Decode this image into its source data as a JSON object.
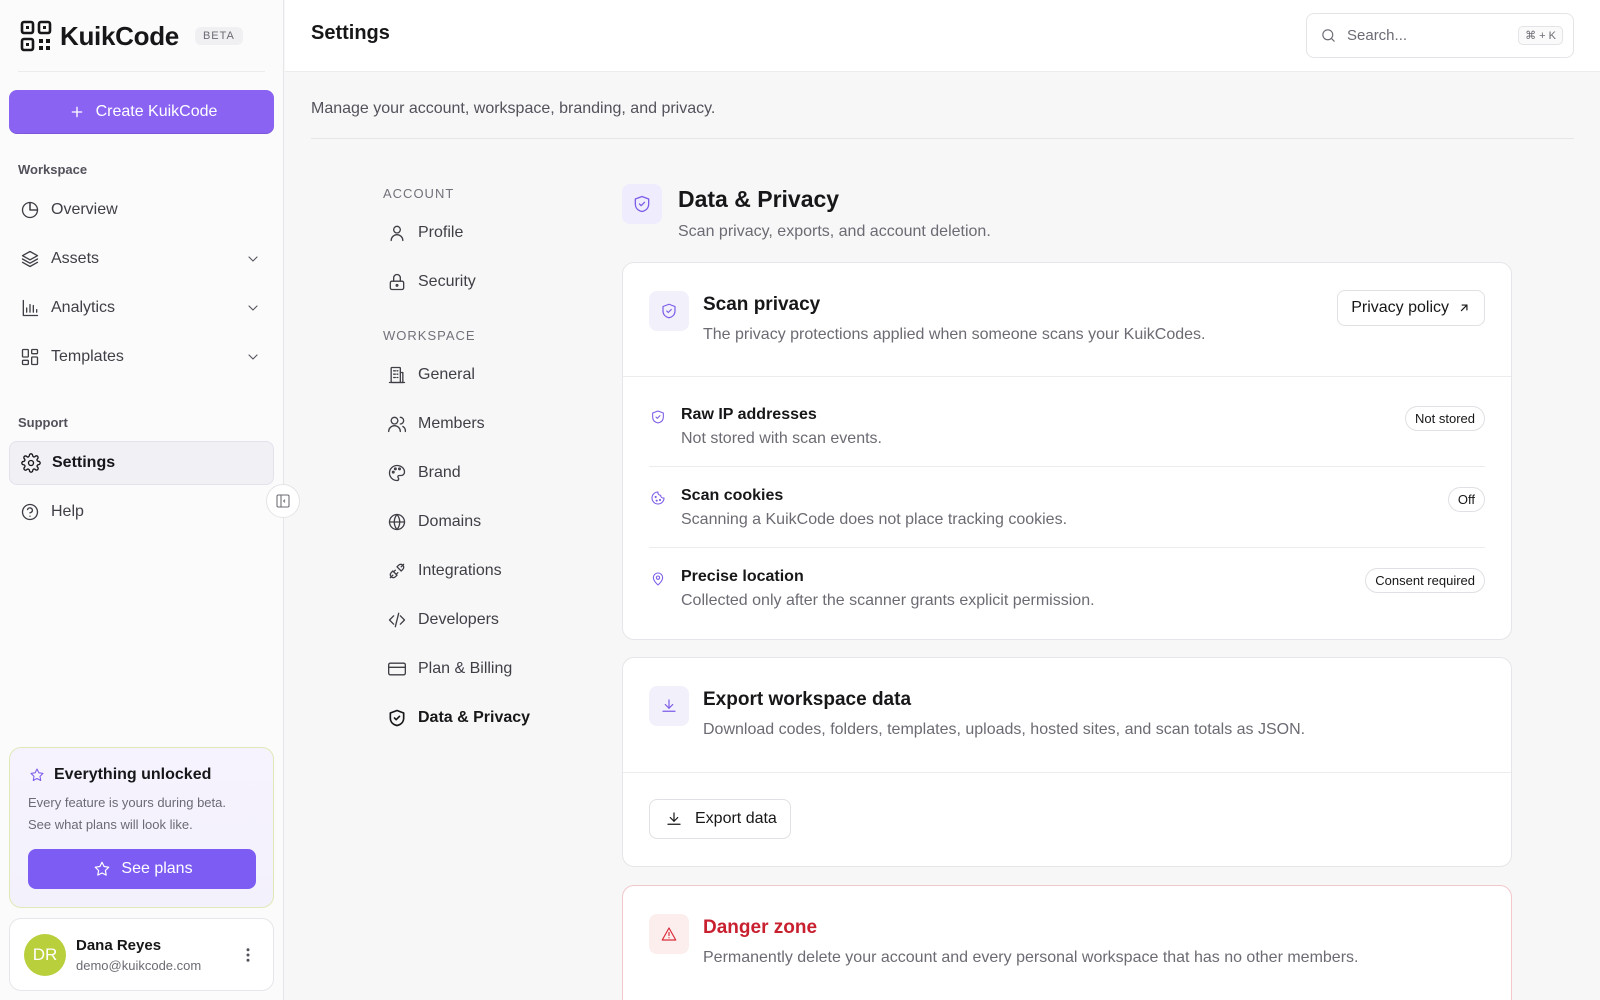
{
  "brand": {
    "name": "KuikCode",
    "badge": "BETA",
    "accent": "#8a63f2"
  },
  "sidebar": {
    "create_label": "Create KuikCode",
    "workspace_label": "Workspace",
    "workspace_items": [
      {
        "label": "Overview",
        "icon": "pie-chart-icon",
        "expandable": false
      },
      {
        "label": "Assets",
        "icon": "layers-icon",
        "expandable": true
      },
      {
        "label": "Analytics",
        "icon": "bar-chart-icon",
        "expandable": true
      },
      {
        "label": "Templates",
        "icon": "layout-grid-icon",
        "expandable": true
      }
    ],
    "support_label": "Support",
    "support_items": [
      {
        "label": "Settings",
        "icon": "gear-icon",
        "active": true
      },
      {
        "label": "Help",
        "icon": "help-circle-icon",
        "active": false
      }
    ],
    "promo": {
      "title": "Everything unlocked",
      "line1": "Every feature is yours during beta.",
      "line2": "See what plans will look like.",
      "button": "See plans"
    },
    "user": {
      "initials": "DR",
      "name": "Dana Reyes",
      "email": "demo@kuikcode.com"
    }
  },
  "header": {
    "title": "Settings",
    "search_placeholder": "Search...",
    "search_shortcut": "⌘ + K"
  },
  "page_subtitle": "Manage your account, workspace, branding, and privacy.",
  "settings_nav": {
    "account_label": "ACCOUNT",
    "account_items": [
      {
        "label": "Profile",
        "icon": "user-icon"
      },
      {
        "label": "Security",
        "icon": "lock-icon"
      }
    ],
    "workspace_label": "WORKSPACE",
    "workspace_items": [
      {
        "label": "General",
        "icon": "building-icon"
      },
      {
        "label": "Members",
        "icon": "users-icon"
      },
      {
        "label": "Brand",
        "icon": "palette-icon"
      },
      {
        "label": "Domains",
        "icon": "globe-icon"
      },
      {
        "label": "Integrations",
        "icon": "plug-icon"
      },
      {
        "label": "Developers",
        "icon": "code-icon"
      },
      {
        "label": "Plan & Billing",
        "icon": "credit-card-icon"
      },
      {
        "label": "Data & Privacy",
        "icon": "shield-check-icon",
        "active": true
      }
    ]
  },
  "content": {
    "title": "Data & Privacy",
    "description": "Scan privacy, exports, and account deletion.",
    "scan_privacy": {
      "title": "Scan privacy",
      "description": "The privacy protections applied when someone scans your KuikCodes.",
      "button": "Privacy policy",
      "rows": [
        {
          "title": "Raw IP addresses",
          "description": "Not stored with scan events.",
          "status": "Not stored",
          "icon": "shield-icon"
        },
        {
          "title": "Scan cookies",
          "description": "Scanning a KuikCode does not place tracking cookies.",
          "status": "Off",
          "icon": "cookie-icon"
        },
        {
          "title": "Precise location",
          "description": "Collected only after the scanner grants explicit permission.",
          "status": "Consent required",
          "icon": "map-pin-icon"
        }
      ]
    },
    "export": {
      "title": "Export workspace data",
      "description": "Download codes, folders, templates, uploads, hosted sites, and scan totals as JSON.",
      "button": "Export data"
    },
    "danger": {
      "title": "Danger zone",
      "description": "Permanently delete your account and every personal workspace that has no other members.",
      "color": "#c8202f"
    }
  }
}
